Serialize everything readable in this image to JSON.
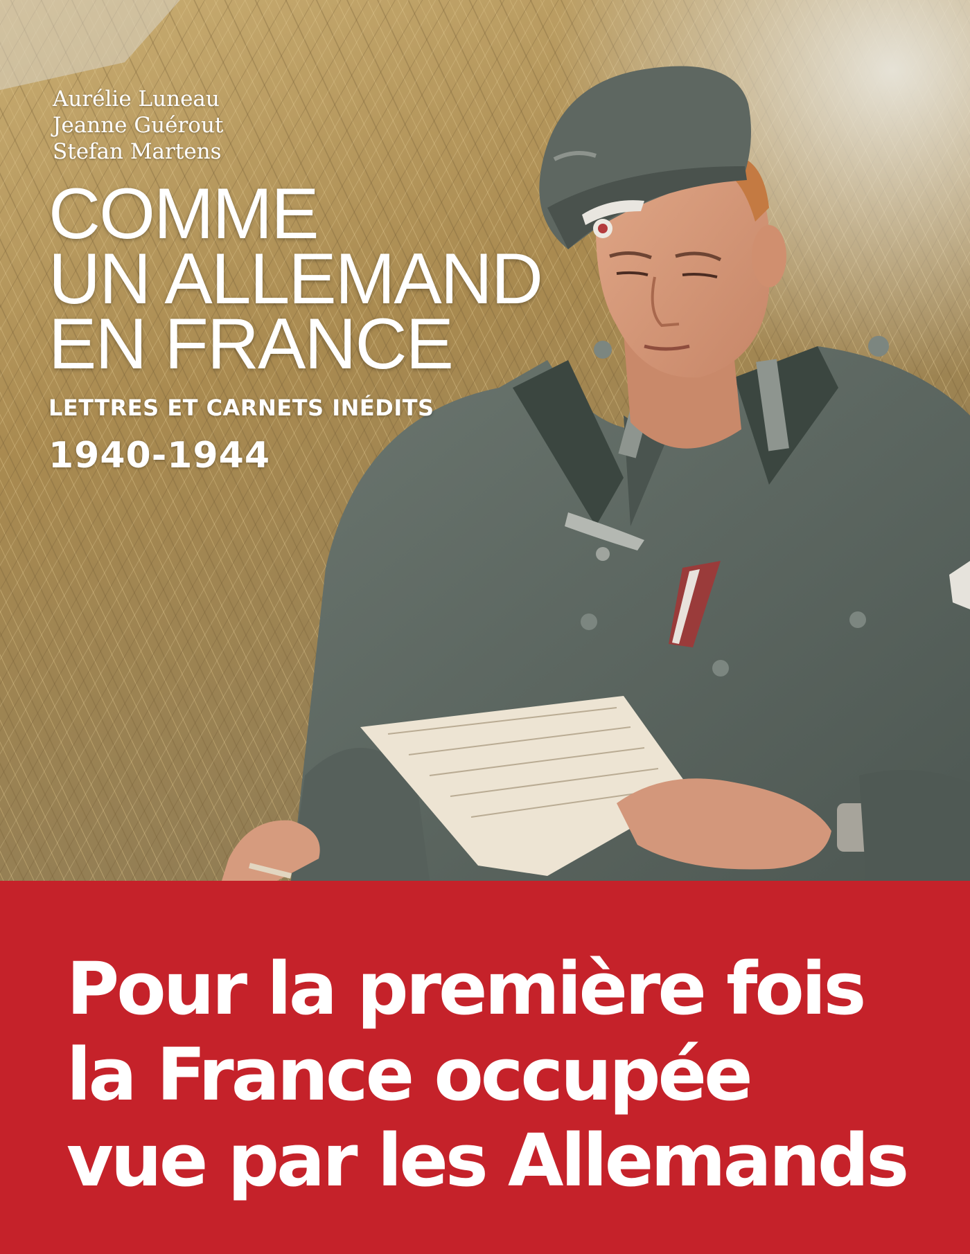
{
  "cover": {
    "authors": [
      "Aurélie Luneau",
      "Jeanne Guérout",
      "Stefan Martens"
    ],
    "title_lines": [
      "COMME",
      "UN ALLEMAND",
      "EN FRANCE"
    ],
    "subtitle": "LETTRES ET CARNETS INÉDITS",
    "years": "1940-1944",
    "banner_lines": [
      "Pour la première fois",
      "la France occupée",
      "vue par les Allemands"
    ]
  },
  "colors": {
    "banner_red": "#c5222a",
    "uniform_grey": "#5d6862",
    "straw": "#b89a5c",
    "text_white": "#ffffff"
  }
}
